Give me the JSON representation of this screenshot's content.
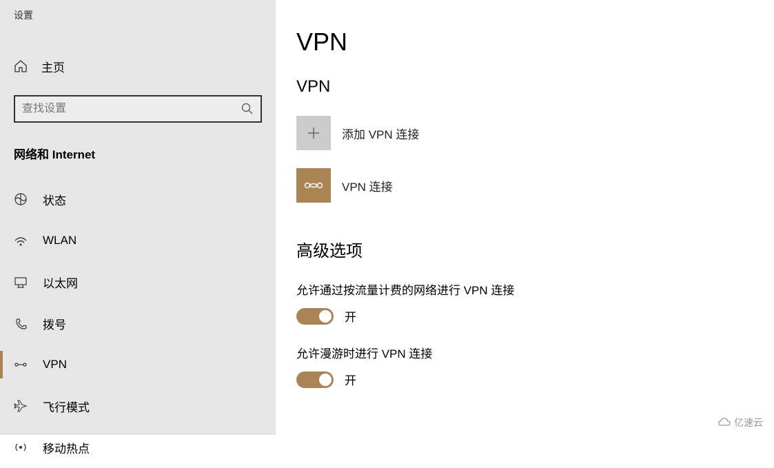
{
  "app_title": "设置",
  "sidebar": {
    "home_label": "主页",
    "search_placeholder": "查找设置",
    "category": "网络和 Internet",
    "items": [
      {
        "label": "状态",
        "icon": "status-icon",
        "selected": false
      },
      {
        "label": "WLAN",
        "icon": "wlan-icon",
        "selected": false
      },
      {
        "label": "以太网",
        "icon": "ethernet-icon",
        "selected": false
      },
      {
        "label": "拨号",
        "icon": "dialup-icon",
        "selected": false
      },
      {
        "label": "VPN",
        "icon": "vpn-icon",
        "selected": true
      },
      {
        "label": "飞行模式",
        "icon": "airplane-icon",
        "selected": false
      },
      {
        "label": "移动热点",
        "icon": "hotspot-icon",
        "selected": false
      }
    ]
  },
  "main": {
    "page_title": "VPN",
    "section_title": "VPN",
    "add_vpn_label": "添加 VPN 连接",
    "connection_label": "VPN 连接",
    "advanced_title": "高级选项",
    "settings": [
      {
        "label": "允许通过按流量计费的网络进行 VPN 连接",
        "state_label": "开",
        "on": true
      },
      {
        "label": "允许漫游时进行 VPN 连接",
        "state_label": "开",
        "on": true
      }
    ]
  },
  "watermark": "亿速云"
}
